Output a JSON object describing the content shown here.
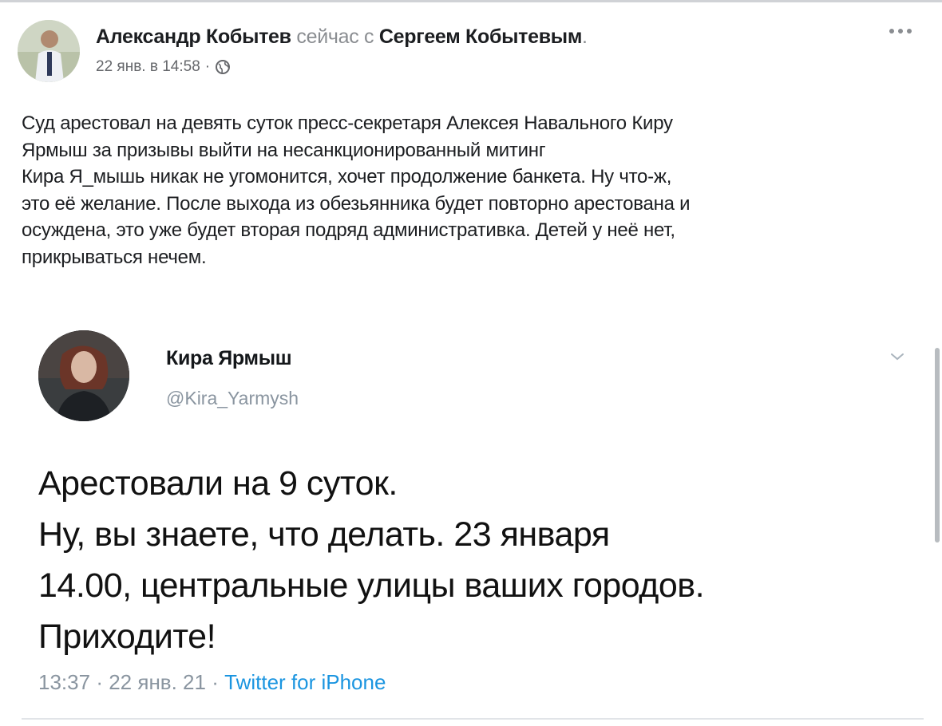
{
  "fb_post": {
    "author": "Александр Кобытев",
    "with_prefix": "сейчас с",
    "tagged": "Сергеем Кобытевым",
    "tagged_suffix": ".",
    "date": "22 янв. в 14:58",
    "separator": "·",
    "privacy_icon": "globe-icon",
    "more_icon": "more-icon",
    "text_lines": [
      "Суд арестовал на девять суток пресс-секретаря Алексея Навального Киру",
      "Ярмыш за призывы выйти на несанкционированный митинг",
      "Кира Я_мышь никак не угомонится, хочет продолжение банкета. Ну что-ж,",
      "это её желание. После выхода из обезьянника будет повторно арестована и",
      "осуждена, это уже будет вторая подряд административка. Детей у неё нет,",
      "прикрываться нечем."
    ]
  },
  "tweet": {
    "name": "Кира Ярмыш",
    "handle": "@Kira_Yarmysh",
    "menu_icon": "chevron-down-icon",
    "text_lines": [
      "Арестовали на 9 суток.",
      "Ну, вы знаете, что делать. 23 января",
      "14.00, центральные улицы ваших городов.",
      "Приходите!"
    ],
    "time": "13:37",
    "separator": "·",
    "date": "22 янв. 21",
    "source": "Twitter for iPhone"
  },
  "colors": {
    "text": "#1c1e21",
    "muted": "#8a8d91",
    "twitter_blue": "#1b95e0",
    "tweet_meta": "#8a95a0"
  }
}
